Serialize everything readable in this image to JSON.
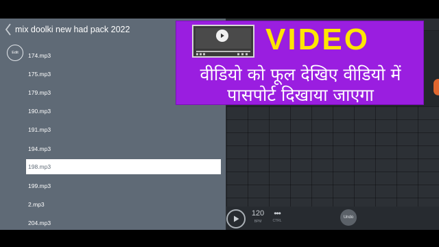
{
  "panel": {
    "title": "mix doolki new had pack 2022",
    "edit_label": "Edit",
    "files": [
      {
        "name": "174.mp3",
        "selected": false
      },
      {
        "name": "175.mp3",
        "selected": false
      },
      {
        "name": "179.mp3",
        "selected": false
      },
      {
        "name": "190.mp3",
        "selected": false
      },
      {
        "name": "191.mp3",
        "selected": false
      },
      {
        "name": "194.mp3",
        "selected": false
      },
      {
        "name": "198.mp3",
        "selected": true
      },
      {
        "name": "199.mp3",
        "selected": false
      },
      {
        "name": "2.mp3",
        "selected": false
      },
      {
        "name": "204.mp3",
        "selected": false
      }
    ]
  },
  "transport": {
    "bpm_value": "120",
    "bpm_label": "BPM",
    "ctrl_dots": "•••",
    "ctrl_label": "CTRL",
    "undo_label": "Undo"
  },
  "banner": {
    "headline": "VIDEO",
    "line1": "वीडियो को फूल देखिए वीडियो में",
    "line2": "पासपोर्ट दिखाया जाएगा",
    "background": "#9a1ee0",
    "headline_color": "#ffe600"
  },
  "colors": {
    "panel_bg": "#5f6a76",
    "selected_row_bg": "#ffffff",
    "accent_orange": "#e0672f"
  },
  "icons": {
    "back": "chevron-left-icon",
    "play": "play-icon",
    "thumbnail": "video-player-icon"
  }
}
